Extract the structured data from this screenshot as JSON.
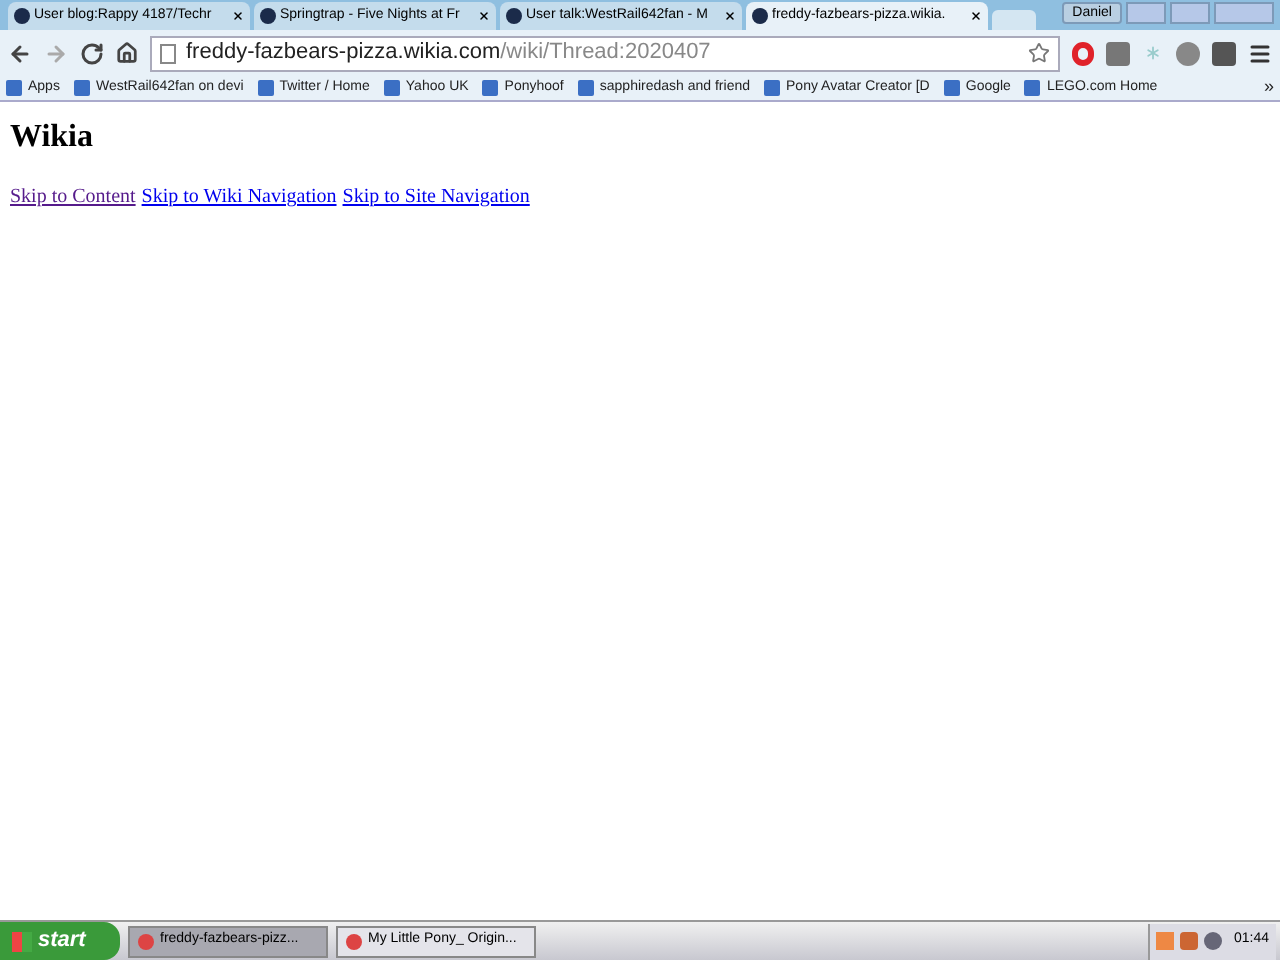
{
  "window": {
    "profile": "Daniel"
  },
  "tabs": [
    {
      "title": "User blog:Rappy 4187/Techr",
      "selected": false
    },
    {
      "title": "Springtrap - Five Nights at Fr",
      "selected": false
    },
    {
      "title": "User talk:WestRail642fan - M",
      "selected": false
    },
    {
      "title": "freddy-fazbears-pizza.wikia.",
      "selected": true
    }
  ],
  "address": {
    "host": "freddy-fazbears-pizza.wikia.com",
    "path": "/wiki/Thread:2020407"
  },
  "bookmarks": [
    "Apps",
    "WestRail642fan on devi",
    "Twitter / Home",
    "Yahoo UK",
    "Ponyhoof",
    "sapphiredash and friend",
    "Pony Avatar Creator [D",
    "Google",
    "LEGO.com Home"
  ],
  "bookmarks_overflow": "»",
  "page": {
    "heading": "Wikia",
    "links": [
      {
        "text": "Skip to Content",
        "visited": true
      },
      {
        "text": "Skip to Wiki Navigation",
        "visited": false
      },
      {
        "text": "Skip to Site Navigation",
        "visited": false
      }
    ]
  },
  "taskbar": {
    "start": "start",
    "tasks": [
      {
        "title": "freddy-fazbears-pizz...",
        "selected": true
      },
      {
        "title": "My Little Pony_ Origin...",
        "selected": false
      }
    ],
    "clock": "01:44"
  }
}
